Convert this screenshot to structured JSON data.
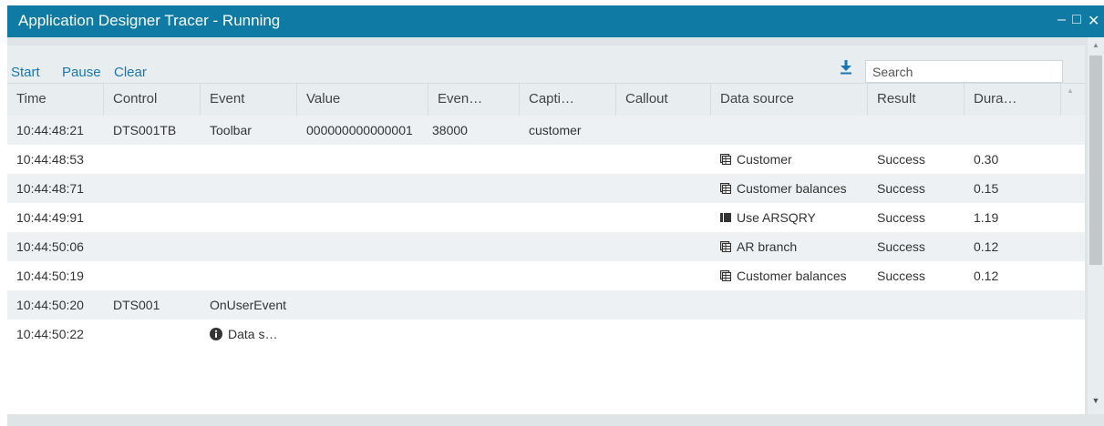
{
  "window": {
    "title": "Application Designer Tracer - Running",
    "controls": {
      "minimize": "–",
      "maximize": "□",
      "close": "✕"
    }
  },
  "toolbar": {
    "start_label": "Start",
    "pause_label": "Pause",
    "clear_label": "Clear",
    "download_icon": "download-icon",
    "search_placeholder": "Search",
    "search_value": ""
  },
  "grid": {
    "columns": [
      "Time",
      "Control",
      "Event",
      "Value",
      "Even…",
      "Capti…",
      "Callout",
      "Data source",
      "Result",
      "Dura…"
    ],
    "rows": [
      {
        "time": "10:44:48:21",
        "control": "DTS001TB",
        "event": "Toolbar",
        "value": "000000000000001",
        "event_id": "38000",
        "caption": "customer",
        "callout": "",
        "datasource": "",
        "datasource_icon": "",
        "result": "",
        "duration": ""
      },
      {
        "time": "10:44:48:53",
        "control": "",
        "event": "",
        "value": "",
        "event_id": "",
        "caption": "",
        "callout": "",
        "datasource": "Customer",
        "datasource_icon": "table-icon",
        "result": "Success",
        "duration": "0.30"
      },
      {
        "time": "10:44:48:71",
        "control": "",
        "event": "",
        "value": "",
        "event_id": "",
        "caption": "",
        "callout": "",
        "datasource": "Customer balances",
        "datasource_icon": "table-icon",
        "result": "Success",
        "duration": "0.15"
      },
      {
        "time": "10:44:49:91",
        "control": "",
        "event": "",
        "value": "",
        "event_id": "",
        "caption": "",
        "callout": "",
        "datasource": "Use ARSQRY",
        "datasource_icon": "query-icon",
        "result": "Success",
        "duration": "1.19"
      },
      {
        "time": "10:44:50:06",
        "control": "",
        "event": "",
        "value": "",
        "event_id": "",
        "caption": "",
        "callout": "",
        "datasource": "AR branch",
        "datasource_icon": "table-icon",
        "result": "Success",
        "duration": "0.12"
      },
      {
        "time": "10:44:50:19",
        "control": "",
        "event": "",
        "value": "",
        "event_id": "",
        "caption": "",
        "callout": "",
        "datasource": "Customer balances",
        "datasource_icon": "table-icon",
        "result": "Success",
        "duration": "0.12"
      },
      {
        "time": "10:44:50:20",
        "control": "DTS001",
        "event": "OnUserEvent",
        "value": "",
        "event_id": "",
        "caption": "",
        "callout": "",
        "datasource": "",
        "datasource_icon": "",
        "result": "",
        "duration": ""
      },
      {
        "time": "10:44:50:22",
        "control": "",
        "event": "Data s…",
        "event_icon": "info-icon",
        "value": "",
        "event_id": "",
        "caption": "",
        "callout": "",
        "datasource": "",
        "datasource_icon": "",
        "result": "",
        "duration": ""
      }
    ]
  },
  "colors": {
    "titlebar_bg": "#0f7ba5",
    "link": "#1a77b3",
    "alt_row": "#eef1f3",
    "panel_bg": "#e8edf0"
  }
}
